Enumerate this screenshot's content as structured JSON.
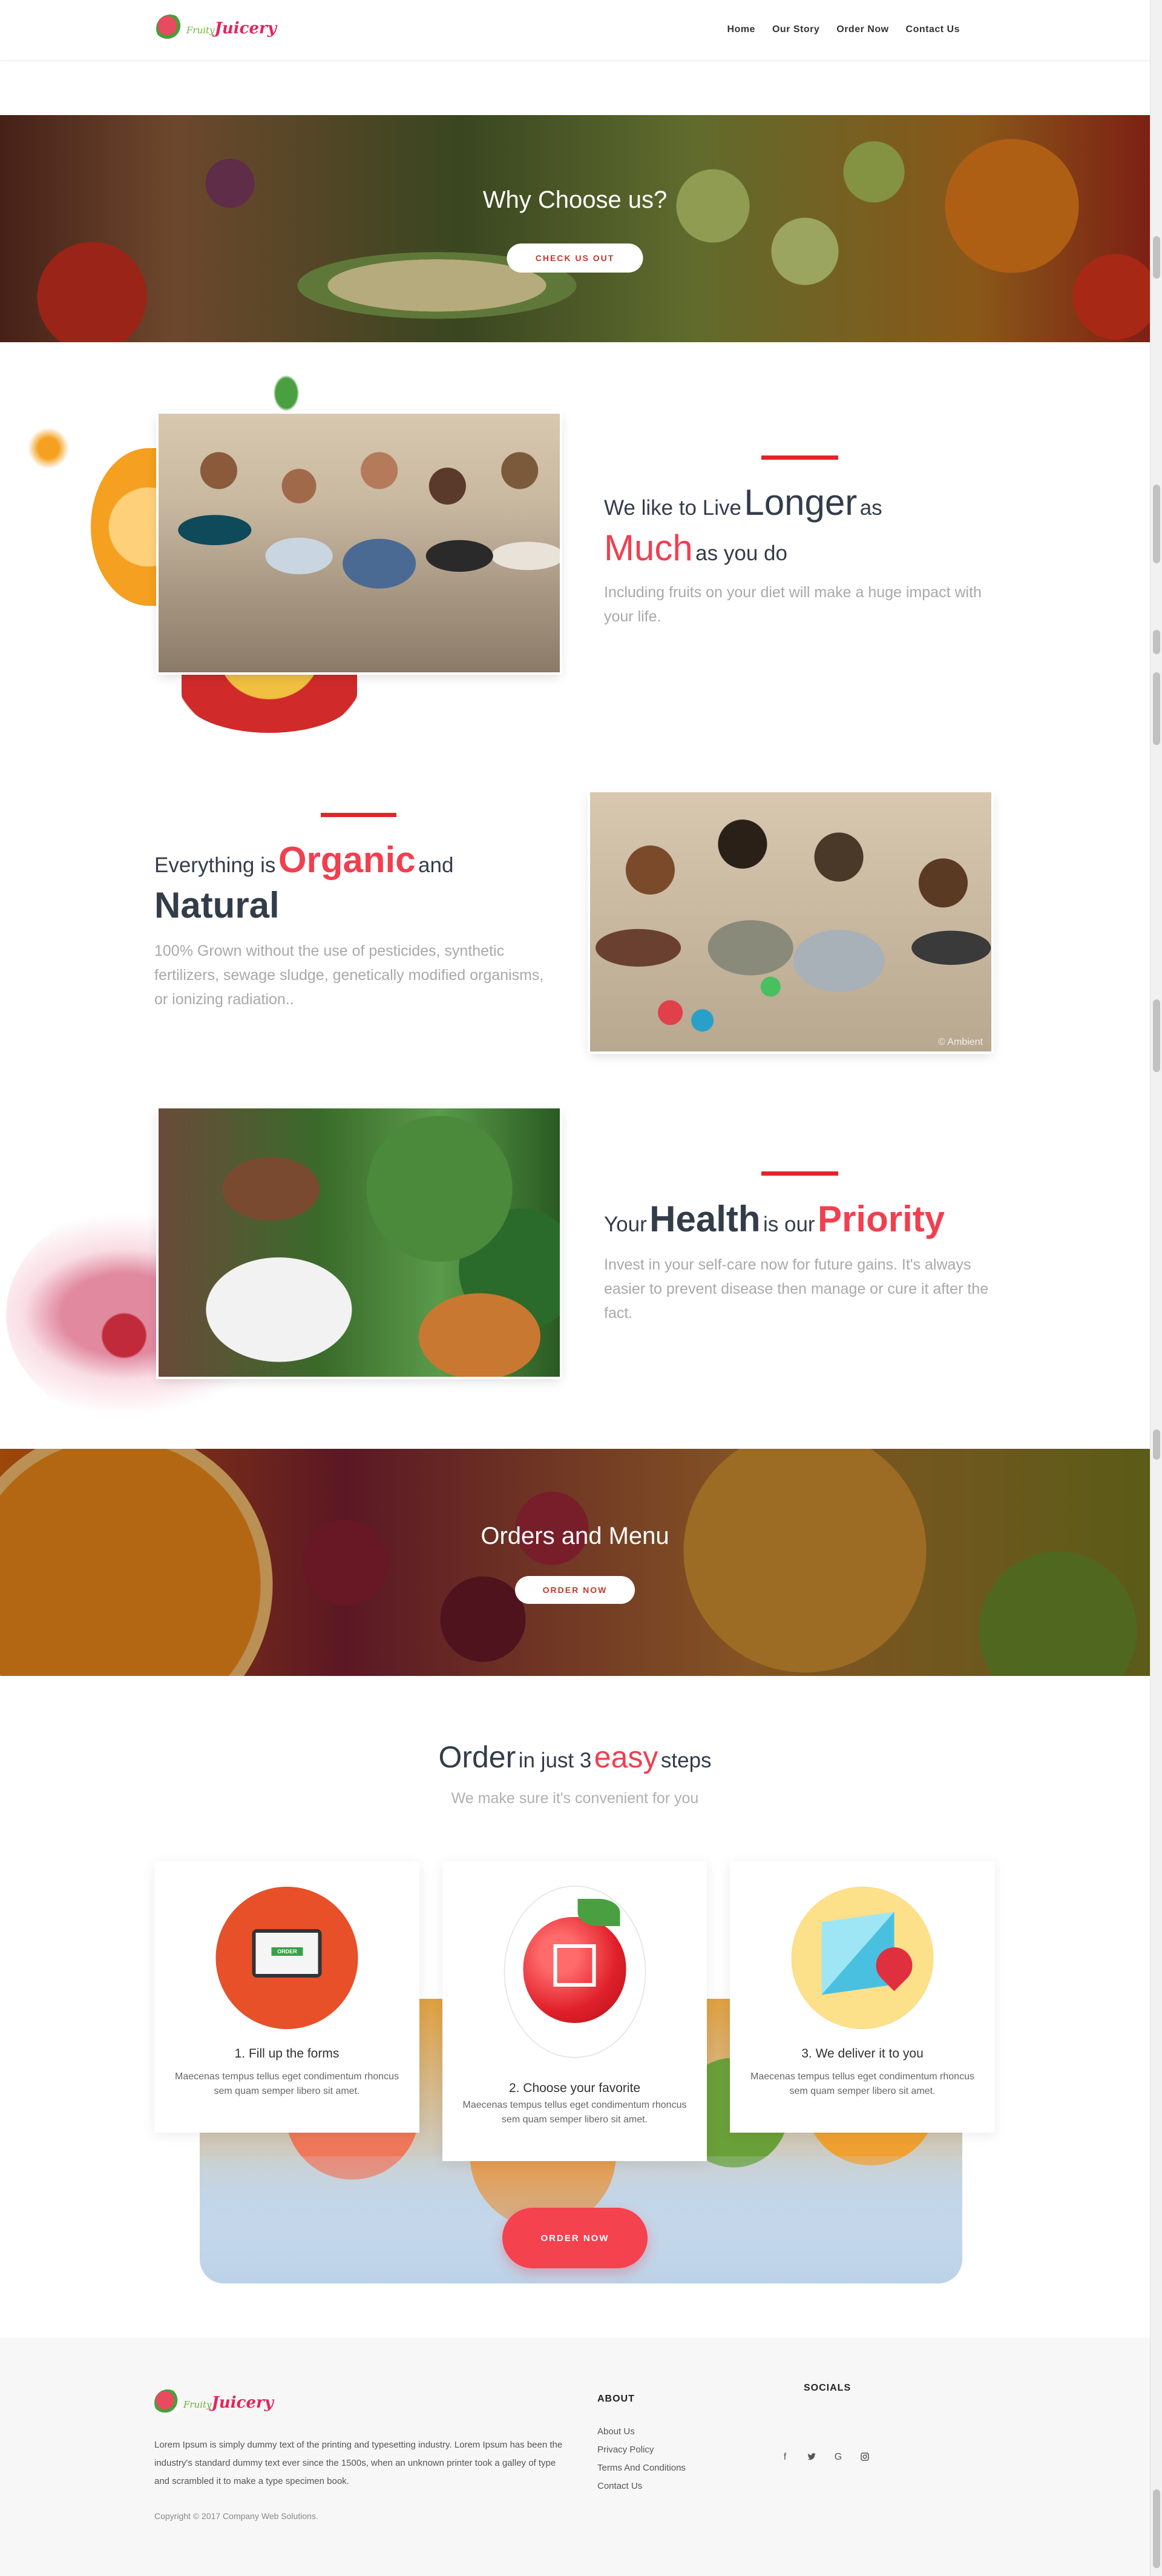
{
  "header": {
    "logo": {
      "part1": "Fruity",
      "part2": "Juicery"
    },
    "nav": [
      "Home",
      "Our Story",
      "Order Now",
      "Contact Us"
    ]
  },
  "banner_why": {
    "title": "Why Choose us?",
    "button": "CHECK US OUT"
  },
  "feature_longer": {
    "w1": "We like to Live",
    "w2": "Longer",
    "w3": "as",
    "w4": "Much",
    "w5": "as you do",
    "desc": "Including fruits on your diet will make a huge impact with your life."
  },
  "feature_organic": {
    "w1": "Everything is",
    "w2": "Organic",
    "w3": "and",
    "w4": "Natural",
    "desc": "100% Grown without the use of pesticides, synthetic fertilizers, sewage sludge, genetically modified organisms, or ionizing radiation..",
    "watermark": "© Ambient"
  },
  "feature_health": {
    "w1": "Your",
    "w2": "Health",
    "w3": "is our",
    "w4": "Priority",
    "desc": "Invest in your self-care now for future gains. It's always easier to prevent disease then manage or cure it after the fact."
  },
  "banner_orders": {
    "title": "Orders and Menu",
    "button": "ORDER NOW"
  },
  "steps": {
    "h1": "Order",
    "h2": "in just 3",
    "h3": "easy",
    "h4": "steps",
    "subtitle": "We make sure it's convenient for you",
    "items": [
      {
        "title": "1. Fill up the forms",
        "text": "Maecenas tempus tellus eget condimentum rhoncus sem quam semper libero sit amet.",
        "icon": "tablet-order-icon",
        "badge": "ORDER"
      },
      {
        "title": "2. Choose your favorite",
        "text": "Maecenas tempus tellus eget condimentum rhoncus sem quam semper libero sit amet.",
        "icon": "apple-check-icon"
      },
      {
        "title": "3. We deliver it to you",
        "text": "Maecenas tempus tellus eget condimentum rhoncus sem quam semper libero sit amet.",
        "icon": "box-location-icon"
      }
    ],
    "button": "ORDER NOW"
  },
  "footer": {
    "logo": {
      "part1": "Fruity",
      "part2": "Juicery"
    },
    "about_text": "Lorem Ipsum is simply dummy text of the printing and typesetting industry. Lorem Ipsum has been the industry's standard dummy text ever since the 1500s, when an unknown printer took a galley of type and scrambled it to make a type specimen book.",
    "copyright": "Copyright © 2017 Company Web Solutions.",
    "about_title": "ABOUT",
    "links": [
      "About Us",
      "Privacy Policy",
      "Terms And Conditions",
      "Contact Us"
    ],
    "socials_title": "SOCIALS",
    "socials": [
      "f",
      "t",
      "G",
      "ig"
    ]
  },
  "colors": {
    "accent_red": "#f04050",
    "line_red": "#e3242b",
    "heading": "#333d4a"
  }
}
